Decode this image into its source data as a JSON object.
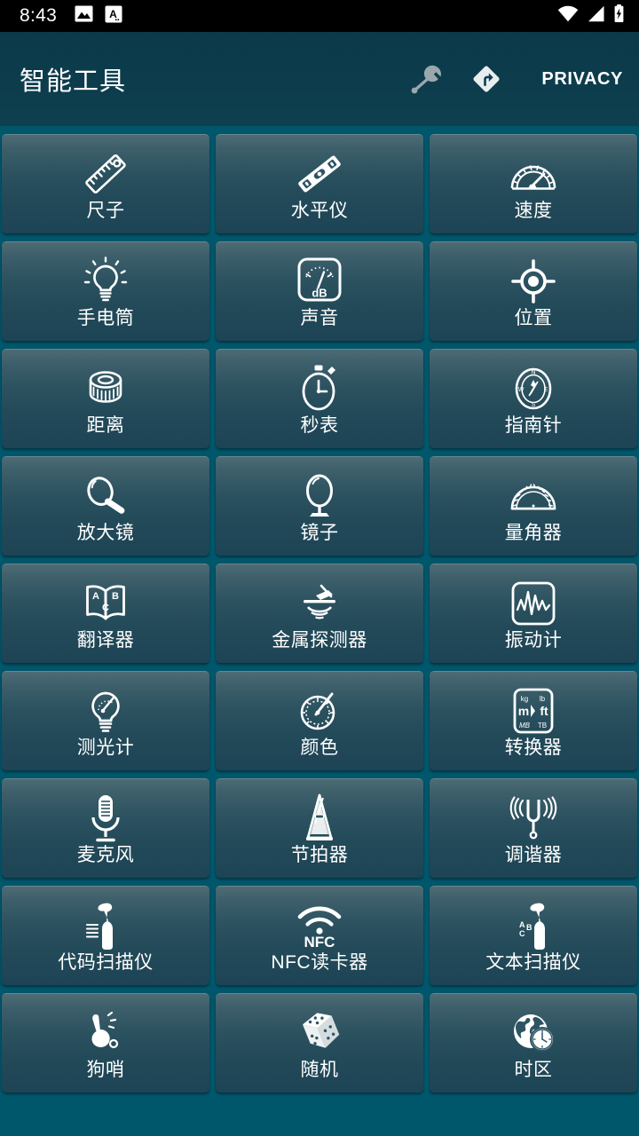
{
  "status_bar": {
    "time": "8:43",
    "left_icons": [
      "image-icon",
      "font-a-icon"
    ],
    "right_icons": [
      "wifi-icon",
      "cellular-signal-icon",
      "battery-charging-icon"
    ]
  },
  "app_bar": {
    "title": "智能工具",
    "actions": [
      {
        "name": "wrench-icon",
        "label": ""
      },
      {
        "name": "directions-icon",
        "label": ""
      }
    ],
    "privacy_label": "PRIVACY"
  },
  "colors": {
    "background": "#00566a",
    "appbar": "#0d3d4d",
    "tile_top": "#4d6b75",
    "tile_bottom": "#1d4455",
    "text": "#ffffff",
    "wrench_gray": "#9aa8ad"
  },
  "tools": [
    {
      "label": "尺子",
      "icon": "ruler-icon"
    },
    {
      "label": "水平仪",
      "icon": "spirit-level-icon"
    },
    {
      "label": "速度",
      "icon": "speedometer-icon"
    },
    {
      "label": "手电筒",
      "icon": "flashlight-bulb-icon"
    },
    {
      "label": "声音",
      "icon": "sound-meter-db-icon"
    },
    {
      "label": "位置",
      "icon": "gps-location-icon"
    },
    {
      "label": "距离",
      "icon": "tape-measure-icon"
    },
    {
      "label": "秒表",
      "icon": "stopwatch-icon"
    },
    {
      "label": "指南针",
      "icon": "compass-icon"
    },
    {
      "label": "放大镜",
      "icon": "magnifier-icon"
    },
    {
      "label": "镜子",
      "icon": "mirror-icon"
    },
    {
      "label": "量角器",
      "icon": "protractor-icon"
    },
    {
      "label": "翻译器",
      "icon": "translate-book-icon"
    },
    {
      "label": "金属探测器",
      "icon": "metal-detector-icon"
    },
    {
      "label": "振动计",
      "icon": "vibration-meter-icon"
    },
    {
      "label": "测光计",
      "icon": "light-meter-icon"
    },
    {
      "label": "颜色",
      "icon": "color-meter-icon"
    },
    {
      "label": "转换器",
      "icon": "unit-converter-icon"
    },
    {
      "label": "麦克风",
      "icon": "microphone-icon"
    },
    {
      "label": "节拍器",
      "icon": "metronome-icon"
    },
    {
      "label": "调谐器",
      "icon": "tuning-fork-icon"
    },
    {
      "label": "代码扫描仪",
      "icon": "barcode-scanner-icon"
    },
    {
      "label": "NFC读卡器",
      "icon": "nfc-icon"
    },
    {
      "label": "文本扫描仪",
      "icon": "text-scanner-icon"
    },
    {
      "label": "狗哨",
      "icon": "dog-whistle-icon"
    },
    {
      "label": "随机",
      "icon": "dice-icon"
    },
    {
      "label": "时区",
      "icon": "timezone-globe-icon"
    }
  ]
}
